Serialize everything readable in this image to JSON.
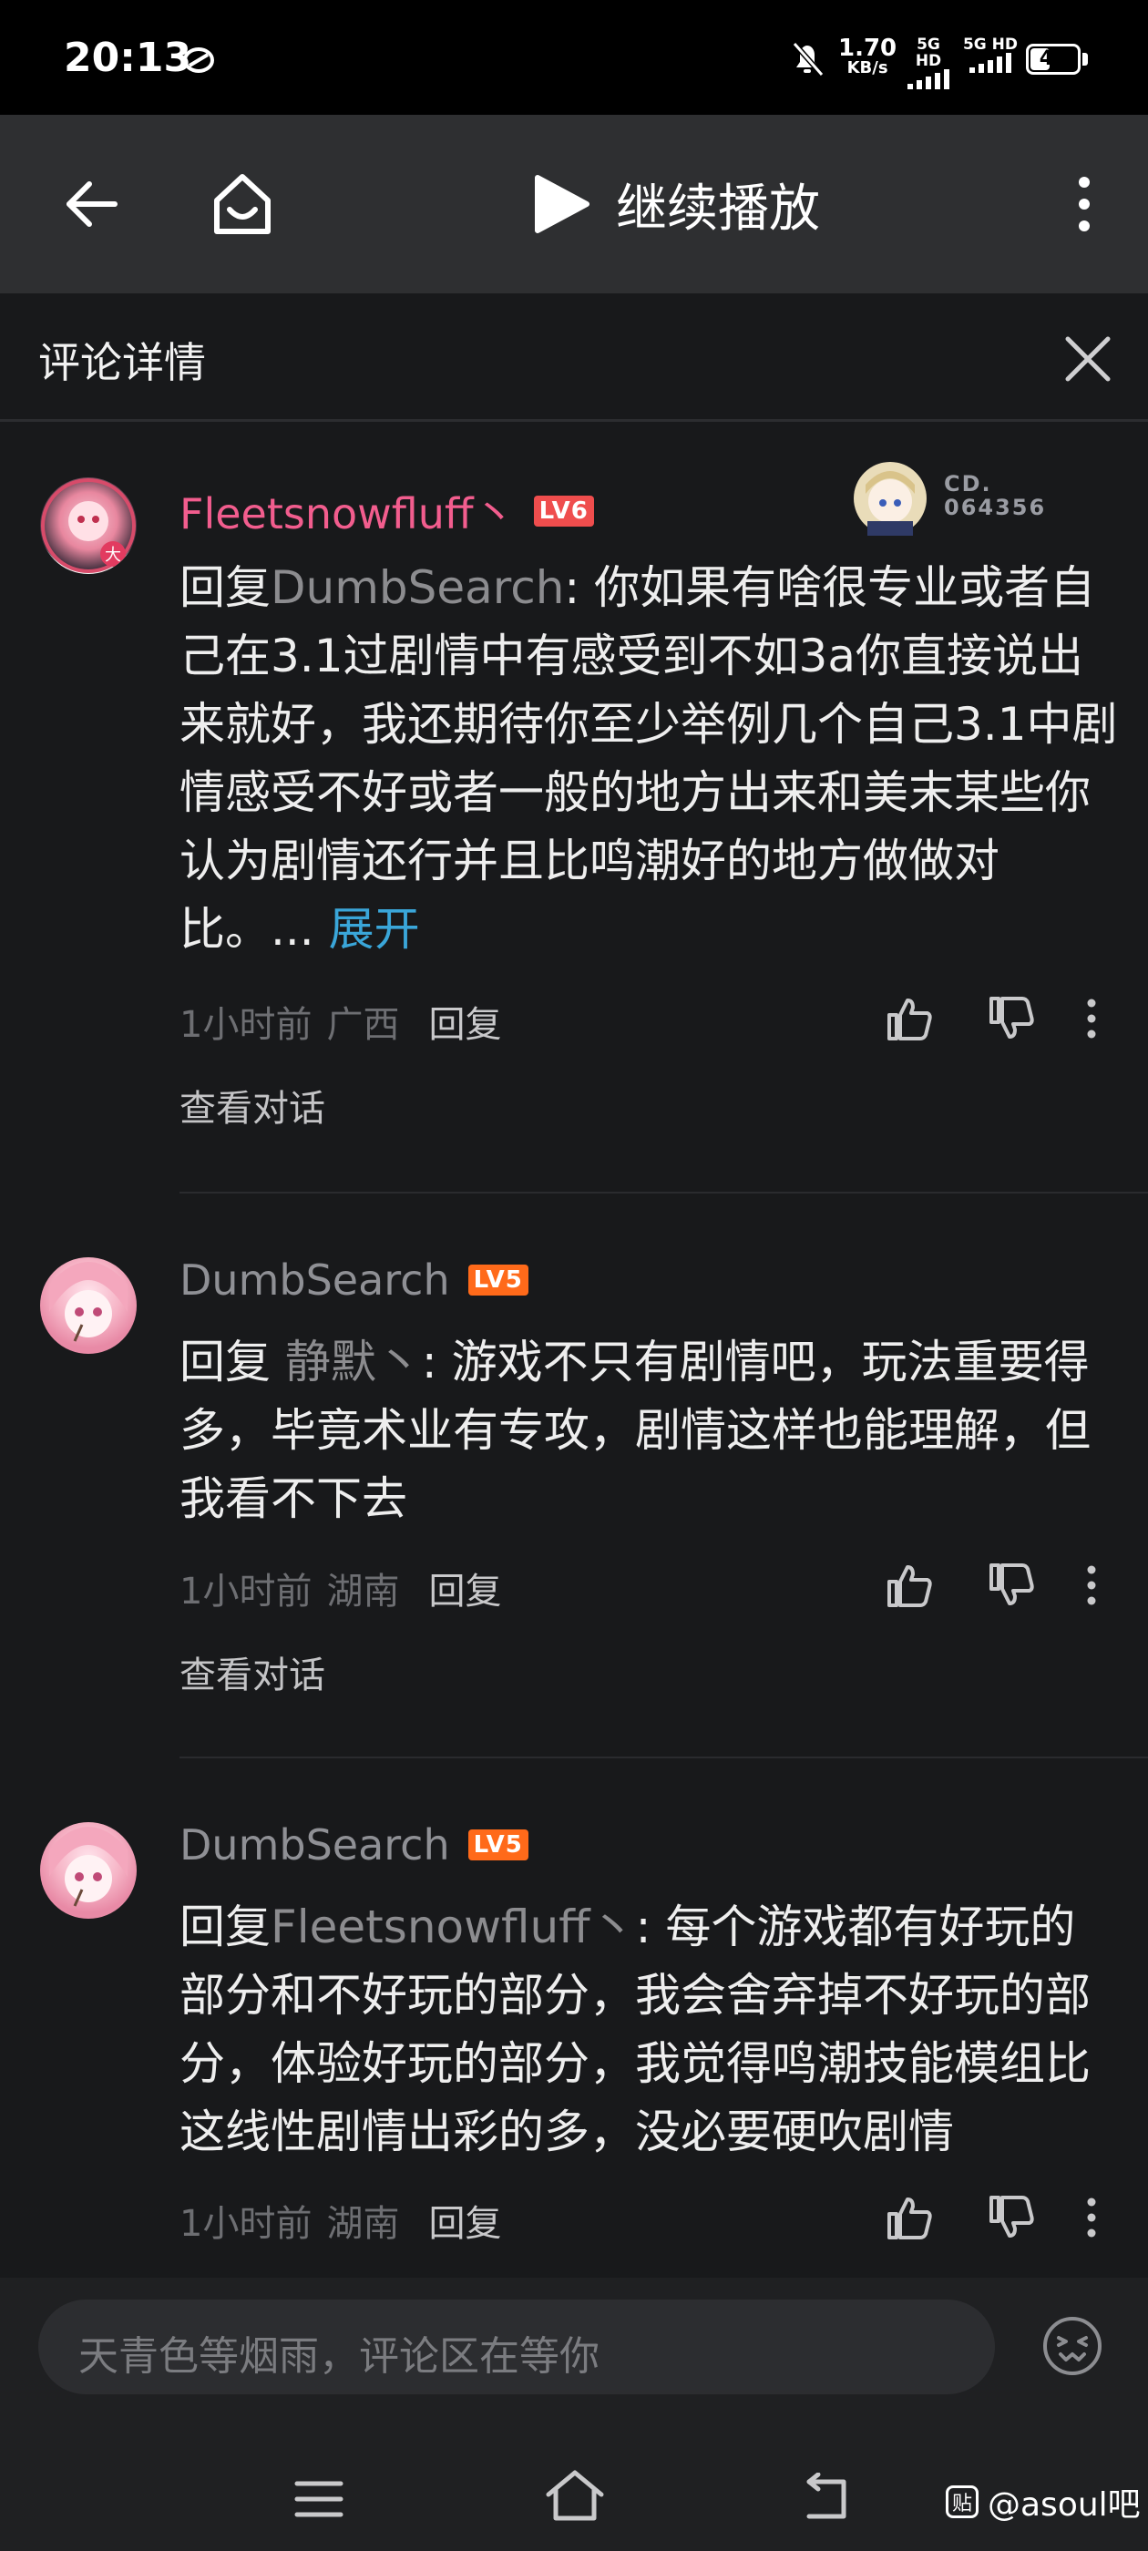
{
  "status_bar": {
    "time": "20:13",
    "net_speed_value": "1.70",
    "net_speed_unit": "KB/s",
    "signal_1": "5G HD",
    "signal_2": "5G HD",
    "battery": "47",
    "battery_level": 0.47
  },
  "top_bar": {
    "resume_label": "继续播放"
  },
  "detail": {
    "title": "评论详情"
  },
  "comments": [
    {
      "username": "Fleetsnowfluff丶",
      "level": "LV6",
      "level_color": "#ef4d4d",
      "name_color": "#f25d8e",
      "badge_text_1": "CD.",
      "badge_text_2": "064356",
      "reply_prefix": "回复",
      "reply_to": "DumbSearch",
      "text": ": 你如果有啥很专业或者自己在3.1过剧情中有感受到不如3a你直接说出来就好，我还期待你至少举例几个自己3.1中剧情感受不好或者一般的地方出来和美末某些你认为剧情还行并且比鸣潮好的地方做做对比。...",
      "expand": "展开",
      "time": "1小时前",
      "location": "广西",
      "reply_label": "回复",
      "view_conversation": "查看对话"
    },
    {
      "username": "DumbSearch",
      "level": "LV5",
      "level_color": "#ff6a1a",
      "name_color": "#8f9095",
      "reply_prefix": "回复",
      "reply_to": "静默丶",
      "text": ": 游戏不只有剧情吧，玩法重要得多，毕竟术业有专攻，剧情这样也能理解，但我看不下去",
      "time": "1小时前",
      "location": "湖南",
      "reply_label": "回复",
      "view_conversation": "查看对话"
    },
    {
      "username": "DumbSearch",
      "level": "LV5",
      "level_color": "#ff6a1a",
      "name_color": "#8f9095",
      "reply_prefix": "回复",
      "reply_to": "Fleetsnowfluff丶",
      "text": ": 每个游戏都有好玩的部分和不好玩的部分，我会舍弃掉不好玩的部分，体验好玩的部分，我觉得鸣潮技能模组比这线性剧情出彩的多，没必要硬吹剧情",
      "time": "1小时前",
      "location": "湖南",
      "reply_label": "回复"
    }
  ],
  "input": {
    "placeholder": "天青色等烟雨，评论区在等你"
  },
  "watermark": {
    "icon_text": "贴",
    "text": "@asoul吧"
  },
  "colors": {
    "background": "#18191b",
    "top_bar": "#2e2f31",
    "link": "#3aa6d9"
  }
}
